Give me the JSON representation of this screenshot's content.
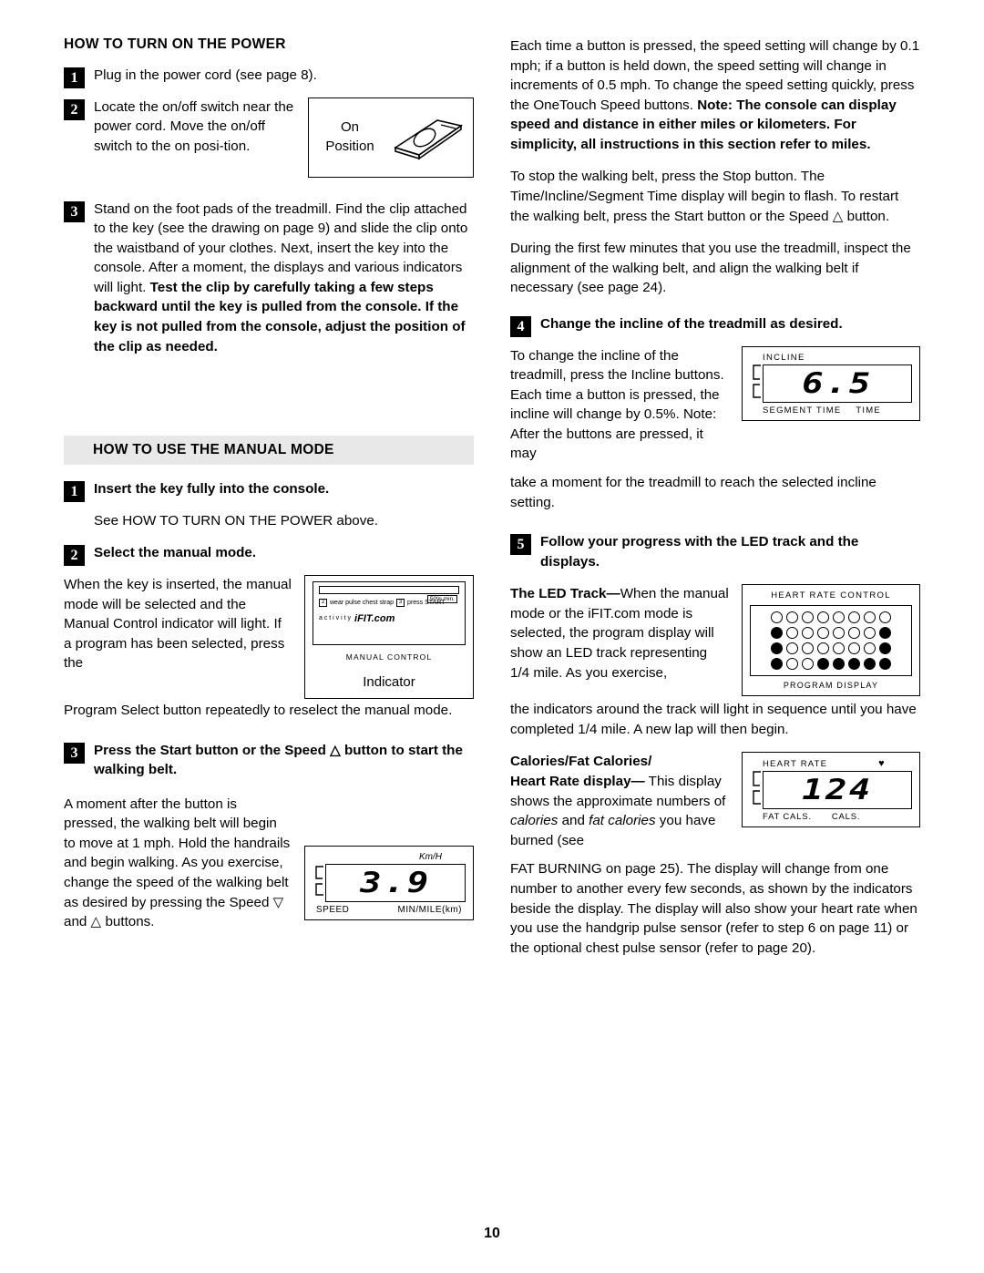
{
  "page": {
    "number": "10"
  },
  "left": {
    "section1": {
      "heading": "HOW TO TURN ON THE POWER",
      "step1": "Plug in the power cord (see page 8).",
      "step2": "Locate the on/off switch near the power cord. Move the on/off switch to the on posi-tion.",
      "fig_onoff": {
        "line1": "On",
        "line2": "Position"
      },
      "step3_normal": "Stand on the foot pads of the treadmill. Find the clip attached to the key (see the drawing on page 9) and slide the clip onto the waistband of your clothes. Next, insert the key into the console. After a moment, the displays and various indicators will light. ",
      "step3_bold": "Test the clip by carefully taking a few steps backward until the key is pulled from the console. If the key is not pulled from the console, adjust the position of the clip as needed."
    },
    "section2": {
      "heading": "HOW TO USE THE MANUAL MODE",
      "step1_bold": "Insert the key fully into the console.",
      "step1_text": "See HOW TO TURN ON THE POWER above.",
      "step2_bold": "Select the manual mode.",
      "step2_text_a": "When the key is inserted, the manual mode will be selected and the Manual Control indicator will light. If a program has been selected, press the",
      "step2_text_b": "Program Select button repeatedly to reselect the manual mode.",
      "fig_console": {
        "label": "Indicator",
        "manual_control": "MANUAL CONTROL",
        "ifit": "iFIT.com",
        "activity": "a c t i v i t y",
        "row1": "wear pulse chest strap",
        "row1_num": "2",
        "row1_num2": "3",
        "row1_press": "press START",
        "pct": "50% min."
      },
      "step3_bold": "Press the Start button or the Speed △ button to start the walking belt.",
      "step3_text_a": "A moment after the button is pressed, the walking belt will begin to move at 1 mph. Hold the handrails and begin walking. As you exercise, change the speed of the walking belt as desired by pressing the Speed ▽ and △ buttons.",
      "fig_speed": {
        "unit": "Km/H",
        "value": "3.9",
        "left_label": "SPEED",
        "right_label": "MIN/MILE(km)"
      }
    }
  },
  "right": {
    "para1_a": "Each time a button is pressed, the speed setting will change by 0.1 mph; if a button is held down, the speed setting will change in increments of 0.5 mph. To change the speed setting quickly, press the OneTouch Speed buttons. ",
    "para1_b": "Note: The console can display speed and distance in either miles or kilometers. For simplicity, all instructions in this section refer to miles.",
    "para2": "To stop the walking belt, press the Stop button. The Time/Incline/Segment Time display will begin to flash. To restart the walking belt, press the Start button or the Speed △ button.",
    "para3": "During the first few minutes that you use the treadmill, inspect the alignment of the walking belt, and align the walking belt if necessary (see page 24).",
    "step4_bold": "Change the incline of the treadmill as desired.",
    "step4_text": "To change the incline of the treadmill, press the Incline buttons. Each time a button is pressed, the incline will change by 0.5%. Note: After the buttons are pressed, it may",
    "step4_text2": "take a moment for the treadmill to reach the selected incline setting.",
    "fig_incline": {
      "title": "INCLINE",
      "value": "6.5",
      "label_left": "SEGMENT TIME",
      "label_right": "TIME"
    },
    "step5_bold": "Follow your progress with the LED track and the displays.",
    "led_track_bold": "The LED Track—",
    "led_track_text": "When the manual mode or the iFIT.com mode is selected, the program display will show an LED track representing 1/4 mile. As you exercise,",
    "led_track_text2": "the indicators around the track will light in sequence until you have completed 1/4 mile. A new lap will then begin.",
    "fig_program": {
      "title": "HEART RATE CONTROL",
      "bottom": "PROGRAM DISPLAY",
      "rows": [
        [
          0,
          0,
          0,
          0,
          0,
          0,
          0,
          0
        ],
        [
          1,
          0,
          0,
          0,
          0,
          0,
          0,
          1
        ],
        [
          1,
          0,
          0,
          0,
          0,
          0,
          0,
          1
        ],
        [
          1,
          0,
          0,
          1,
          1,
          1,
          1,
          1
        ]
      ]
    },
    "calories_bold_1": "Calories/Fat Calories/",
    "calories_bold_2": "Heart Rate display—",
    "calories_text_a": "This display shows the approximate numbers of ",
    "calories_text_italic": "calories",
    "calories_text_b": " and ",
    "calories_text_italic2": "fat calories",
    "calories_text_c": " you have burned (see",
    "calories_text2": "FAT BURNING on page 25). The display will change from one number to another every few seconds, as shown by the indicators beside the display. The display will also show your heart rate when you use the handgrip pulse sensor (refer to step 6 on page 11) or the optional chest pulse sensor (refer to page 20).",
    "fig_heart": {
      "title": "HEART RATE",
      "heart": "♥",
      "value": "124",
      "label_left": "FAT CALS.",
      "label_right": "CALS."
    }
  }
}
